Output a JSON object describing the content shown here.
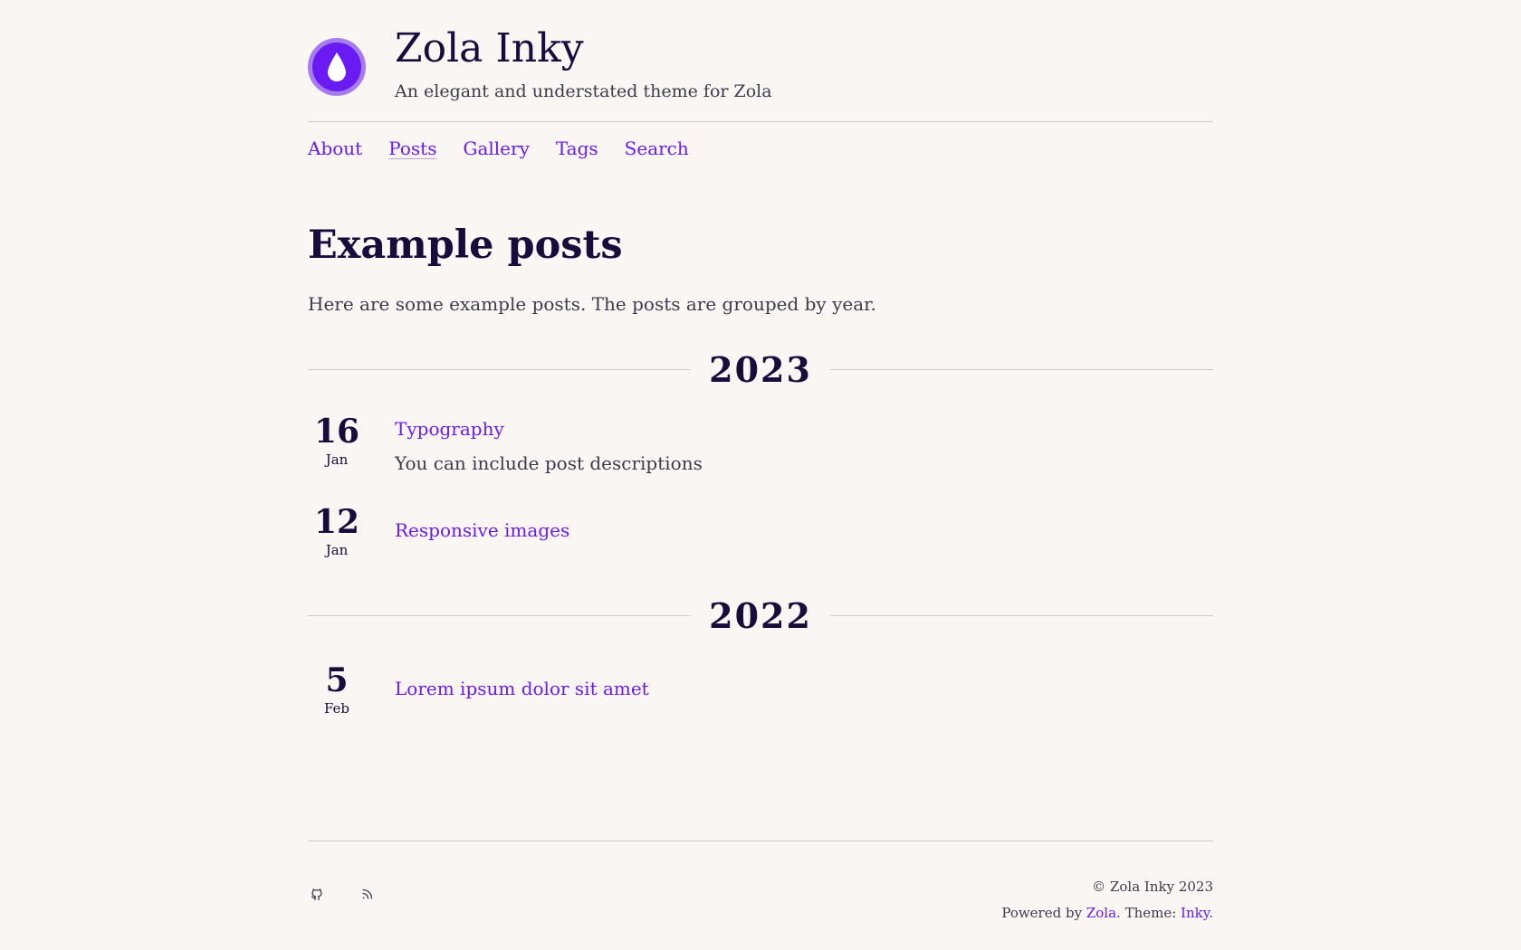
{
  "header": {
    "title": "Zola Inky",
    "tagline": "An elegant and understated theme for Zola",
    "logo_icon": "ink-drop-icon"
  },
  "nav": {
    "items": [
      {
        "label": "About"
      },
      {
        "label": "Posts",
        "active": true
      },
      {
        "label": "Gallery"
      },
      {
        "label": "Tags"
      },
      {
        "label": "Search"
      }
    ]
  },
  "main": {
    "title": "Example posts",
    "intro": "Here are some example posts. The posts are grouped by year.",
    "groups": [
      {
        "year": "2023",
        "posts": [
          {
            "day": "16",
            "month": "Jan",
            "title": "Typography",
            "description": "You can include post descriptions"
          },
          {
            "day": "12",
            "month": "Jan",
            "title": "Responsive images",
            "description": ""
          }
        ]
      },
      {
        "year": "2022",
        "posts": [
          {
            "day": "5",
            "month": "Feb",
            "title": "Lorem ipsum dolor sit amet",
            "description": ""
          }
        ]
      }
    ]
  },
  "footer": {
    "icons": [
      "github-icon",
      "rss-icon"
    ],
    "copyright": "© Zola Inky 2023",
    "powered_prefix": "Powered by ",
    "powered_link": "Zola",
    "theme_prefix": ". Theme: ",
    "theme_link": "Inky",
    "theme_suffix": "."
  },
  "colors": {
    "background": "#f9f6f4",
    "accent": "#6a1bf3",
    "heading": "#1a0b3d",
    "text": "#3f3a4a",
    "rule": "#cfcacc"
  }
}
